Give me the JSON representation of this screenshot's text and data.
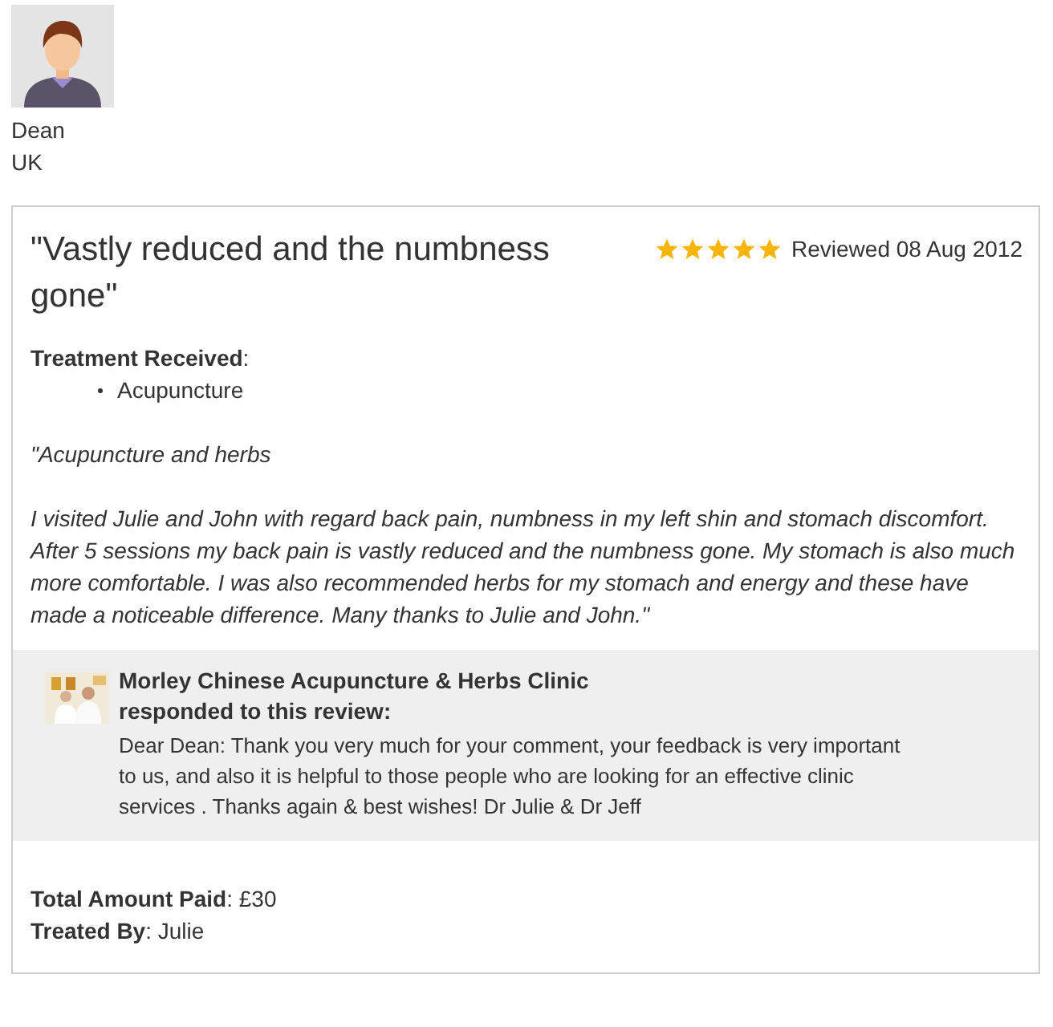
{
  "reviewer": {
    "name": "Dean",
    "country": "UK"
  },
  "review": {
    "title": "\"Vastly reduced and the numbness gone\"",
    "stars": 5,
    "date": "Reviewed 08 Aug 2012",
    "treatment_label": "**Treatment Received**:",
    "treatments": [
      "Acupuncture"
    ],
    "paragraphs": [
      "\"Acupuncture and herbs",
      "I visited Julie and John with regard back pain, numbness in my left shin and stomach discomfort. After 5 sessions my back pain is vastly reduced and the numbness gone. My stomach is also much more comfortable. I was also recommended herbs for my stomach and energy and these have made a noticeable difference. Many thanks to Julie and John.\""
    ],
    "response": {
      "clinic": "Morley Chinese Acupuncture & Herbs Clinic",
      "action": "**responded to this review**:",
      "text": "Dear Dean: Thank you very much for your comment, your feedback is very important to us, and also it is helpful to those people who are looking for an effective clinic services . Thanks again & best wishes! Dr Julie & Dr Jeff"
    },
    "details": [
      "**Total Amount Paid**: £30",
      "**Treated By**: Julie"
    ]
  }
}
